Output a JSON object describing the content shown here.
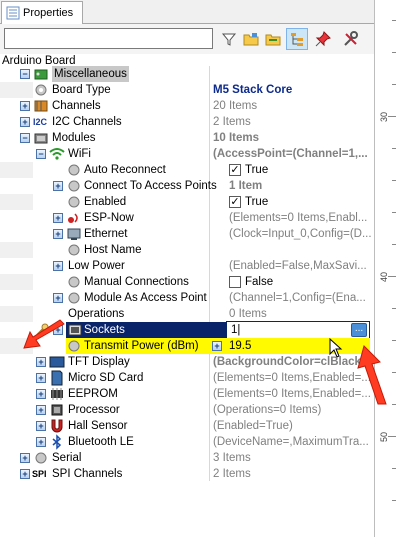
{
  "tab": {
    "label": "Properties"
  },
  "search": {
    "value": ""
  },
  "board_label": "Arduino Board",
  "rows": [
    {
      "name": "Miscellaneous",
      "value": ""
    },
    {
      "name": "Board Type",
      "value": "M5 Stack Core"
    },
    {
      "name": "Channels",
      "value": "20 Items"
    },
    {
      "name": "I2C Channels",
      "value": "2 Items"
    },
    {
      "name": "Modules",
      "value": "10 Items"
    },
    {
      "name": "WiFi",
      "value": "(AccessPoint=(Channel=1,..."
    },
    {
      "name": "Auto Reconnect",
      "value": "True"
    },
    {
      "name": "Connect To Access Points",
      "value": "1 Item"
    },
    {
      "name": "Enabled",
      "value": "True"
    },
    {
      "name": "ESP-Now",
      "value": "(Elements=0 Items,Enabl..."
    },
    {
      "name": "Ethernet",
      "value": "(Clock=Input_0,Config=(D..."
    },
    {
      "name": "Host Name",
      "value": ""
    },
    {
      "name": "Low Power",
      "value": "(Enabled=False,MaxSavi..."
    },
    {
      "name": "Manual Connections",
      "value": "False"
    },
    {
      "name": "Module As Access Point",
      "value": "(Channel=1,Config=(Ena..."
    },
    {
      "name": "Operations",
      "value": "0 Items"
    },
    {
      "name": "Sockets",
      "value": "1|"
    },
    {
      "name": "Transmit Power (dBm)",
      "value": "19.5"
    },
    {
      "name": "TFT Display",
      "value": "(BackgroundColor=clBlack,..."
    },
    {
      "name": "Micro SD Card",
      "value": "(Elements=0 Items,Enabled=..."
    },
    {
      "name": "EEPROM",
      "value": "(Elements=0 Items,Enabled=..."
    },
    {
      "name": "Processor",
      "value": "(Operations=0 Items)"
    },
    {
      "name": "Hall Sensor",
      "value": "(Enabled=True)"
    },
    {
      "name": "Bluetooth LE",
      "value": "(DeviceName=,MaximumTra..."
    },
    {
      "name": "Serial",
      "value": "3 Items"
    },
    {
      "name": "SPI Channels",
      "value": "2 Items"
    }
  ],
  "icon_text": {
    "i2c": "I2C",
    "spi": "SPI"
  },
  "ellipsis_label": "...",
  "ruler": {
    "labels": [
      "30",
      "40",
      "50"
    ]
  },
  "colors": {
    "selection": "#0a246a",
    "highlight": "#fffa00",
    "arrow": "#ff3b21"
  }
}
